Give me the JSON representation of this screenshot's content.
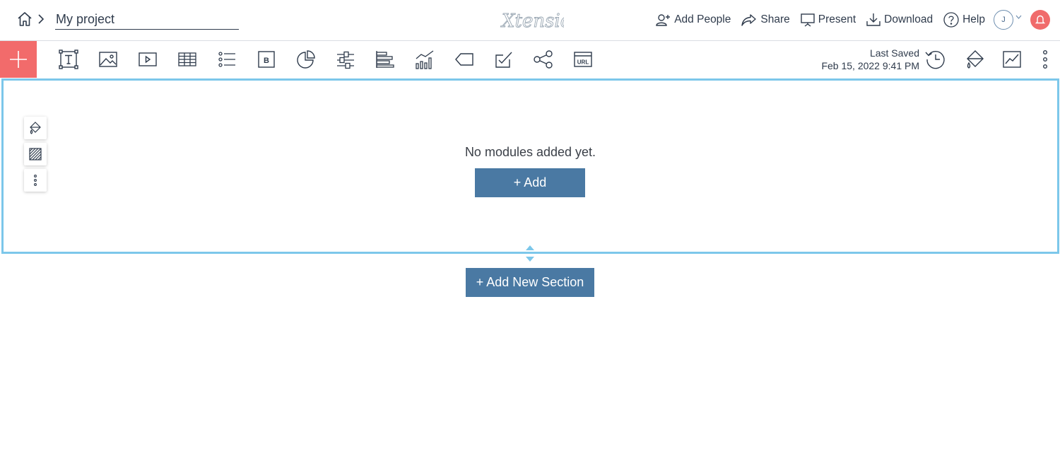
{
  "header": {
    "project_name": "My project",
    "logo_text": "Xtensio",
    "actions": {
      "add_people": "Add People",
      "share": "Share",
      "present": "Present",
      "download": "Download",
      "help": "Help"
    },
    "avatar_initial": "J"
  },
  "toolbar": {
    "tools": [
      "text-tool",
      "image-tool",
      "video-tool",
      "table-tool",
      "list-tool",
      "button-tool",
      "pie-chart-tool",
      "slider-tool",
      "bar-chart-tool",
      "line-chart-tool",
      "tag-tool",
      "checklist-tool",
      "social-share-tool",
      "url-embed-tool"
    ],
    "button_label": "B",
    "url_label": "URL",
    "last_saved_label": "Last Saved",
    "last_saved_time": "Feb 15, 2022 9:41 PM"
  },
  "section": {
    "empty_message": "No modules added yet.",
    "add_button": "+ Add"
  },
  "add_section_button": "+ Add New Section",
  "colors": {
    "accent_red": "#f26b6b",
    "button_blue": "#4a79a3",
    "section_border": "#7cc7ea",
    "text": "#2f3b4c"
  }
}
